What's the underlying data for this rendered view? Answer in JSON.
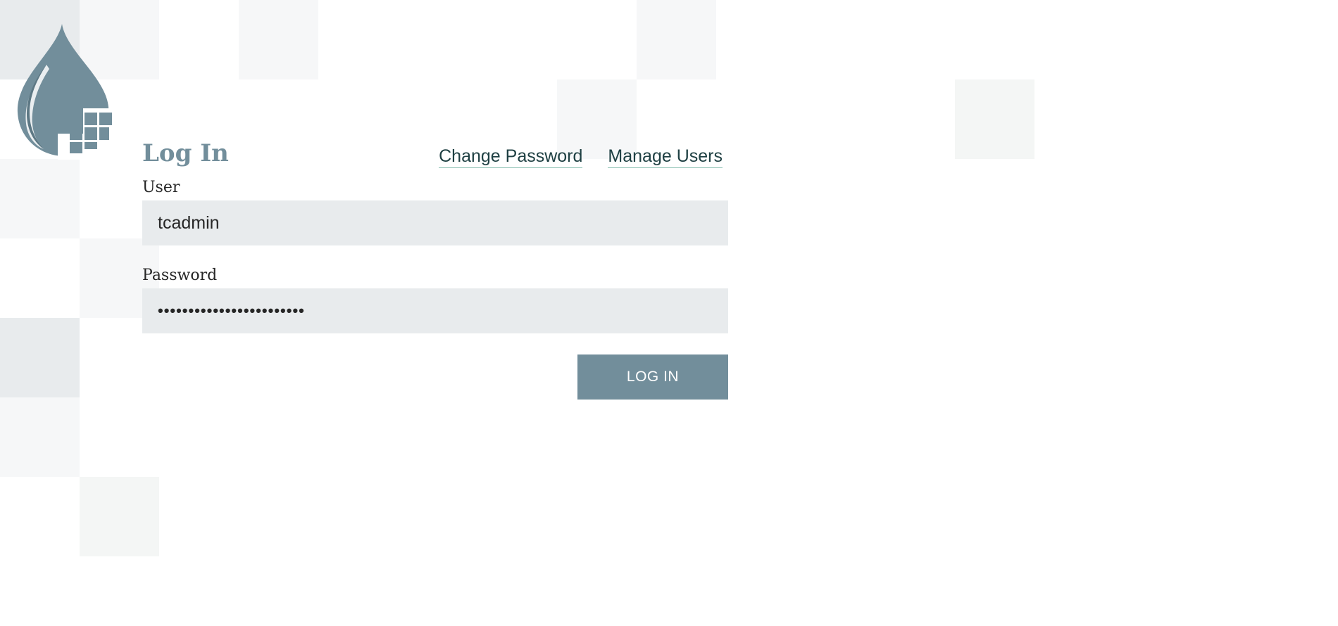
{
  "login": {
    "title": "Log In",
    "links": {
      "change_password": "Change Password",
      "manage_users": "Manage Users"
    },
    "user": {
      "label": "User",
      "value": "tcadmin"
    },
    "password": {
      "label": "Password",
      "value": "••••••••••••••••••••••••"
    },
    "submit_label": "LOG IN"
  },
  "colors": {
    "brand": "#728e9b",
    "link": "#1f4043",
    "link_underline": "#8fc2b5",
    "input_background": "#e8ebed",
    "page_background": "#ffffff"
  },
  "icons": {
    "logo": "droplet-grid-logo-icon"
  }
}
